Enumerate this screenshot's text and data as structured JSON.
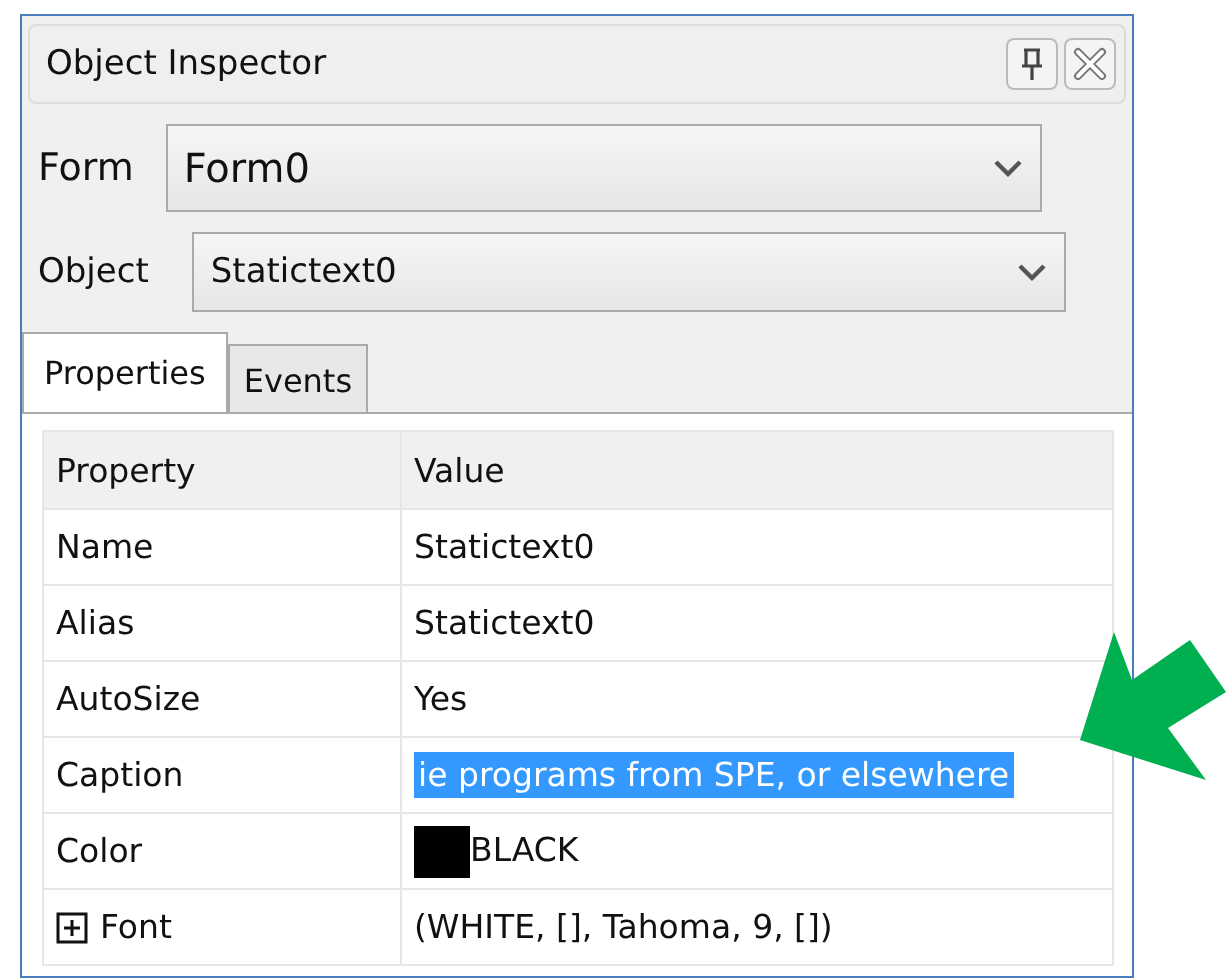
{
  "window": {
    "title": "Object Inspector"
  },
  "form_selector": {
    "label": "Form",
    "value": "Form0"
  },
  "object_selector": {
    "label": "Object",
    "value": "Statictext0"
  },
  "tabs": [
    {
      "label": "Properties",
      "selected": true
    },
    {
      "label": "Events",
      "selected": false
    }
  ],
  "table": {
    "columns": [
      "Property",
      "Value"
    ],
    "rows": [
      {
        "property": "Name",
        "value": "Statictext0",
        "selected": false
      },
      {
        "property": "Alias",
        "value": "Statictext0",
        "selected": false
      },
      {
        "property": "AutoSize",
        "value": "Yes",
        "selected": false
      },
      {
        "property": "Caption",
        "value": "ie programs from SPE, or elsewhere",
        "selected": true
      },
      {
        "property": "Color",
        "value": "BLACK",
        "selected": false,
        "color": "#000000"
      },
      {
        "property": "Font",
        "value": "(WHITE, [], Tahoma, 9, [])",
        "selected": false,
        "expanded": false
      }
    ]
  }
}
